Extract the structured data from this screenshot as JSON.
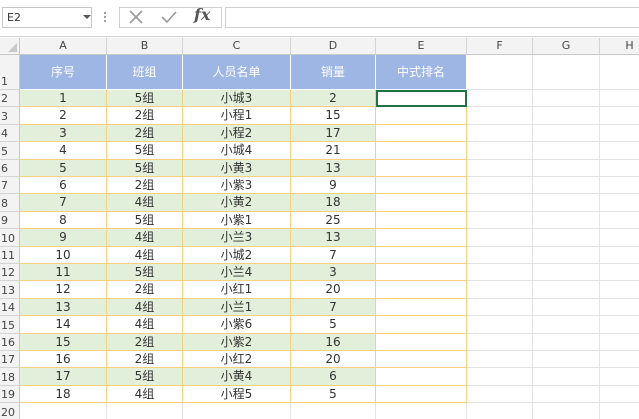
{
  "formula_bar": {
    "name_box": "E2",
    "cancel_icon": "cancel-x-icon",
    "enter_icon": "checkmark-icon",
    "fx_label": "fx",
    "formula": ""
  },
  "columns": [
    "A",
    "B",
    "C",
    "D",
    "E",
    "F",
    "G",
    "H"
  ],
  "row_numbers": [
    "1",
    "2",
    "3",
    "4",
    "5",
    "6",
    "7",
    "8",
    "9",
    "10",
    "11",
    "12",
    "13",
    "14",
    "15",
    "16",
    "17",
    "18",
    "19",
    "20"
  ],
  "table": {
    "headers": [
      "序号",
      "班组",
      "人员名单",
      "销量",
      "中式排名"
    ],
    "rows": [
      [
        "1",
        "5组",
        "小城3",
        "2",
        ""
      ],
      [
        "2",
        "2组",
        "小程1",
        "15",
        ""
      ],
      [
        "3",
        "2组",
        "小程2",
        "17",
        ""
      ],
      [
        "4",
        "5组",
        "小城4",
        "21",
        ""
      ],
      [
        "5",
        "5组",
        "小黄3",
        "13",
        ""
      ],
      [
        "6",
        "2组",
        "小紫3",
        "9",
        ""
      ],
      [
        "7",
        "4组",
        "小黄2",
        "18",
        ""
      ],
      [
        "8",
        "5组",
        "小紫1",
        "25",
        ""
      ],
      [
        "9",
        "4组",
        "小兰3",
        "13",
        ""
      ],
      [
        "10",
        "4组",
        "小城2",
        "7",
        ""
      ],
      [
        "11",
        "5组",
        "小兰4",
        "3",
        ""
      ],
      [
        "12",
        "2组",
        "小红1",
        "20",
        ""
      ],
      [
        "13",
        "4组",
        "小兰1",
        "7",
        ""
      ],
      [
        "14",
        "4组",
        "小紫6",
        "5",
        ""
      ],
      [
        "15",
        "2组",
        "小紫2",
        "16",
        ""
      ],
      [
        "16",
        "2组",
        "小红2",
        "20",
        ""
      ],
      [
        "17",
        "5组",
        "小黄4",
        "6",
        ""
      ],
      [
        "18",
        "4组",
        "小程5",
        "5",
        ""
      ]
    ]
  },
  "colors": {
    "header_fill": "#9db6e3",
    "band_fill": "#e2efda",
    "table_border": "#f2d27a",
    "selection": "#217346"
  }
}
